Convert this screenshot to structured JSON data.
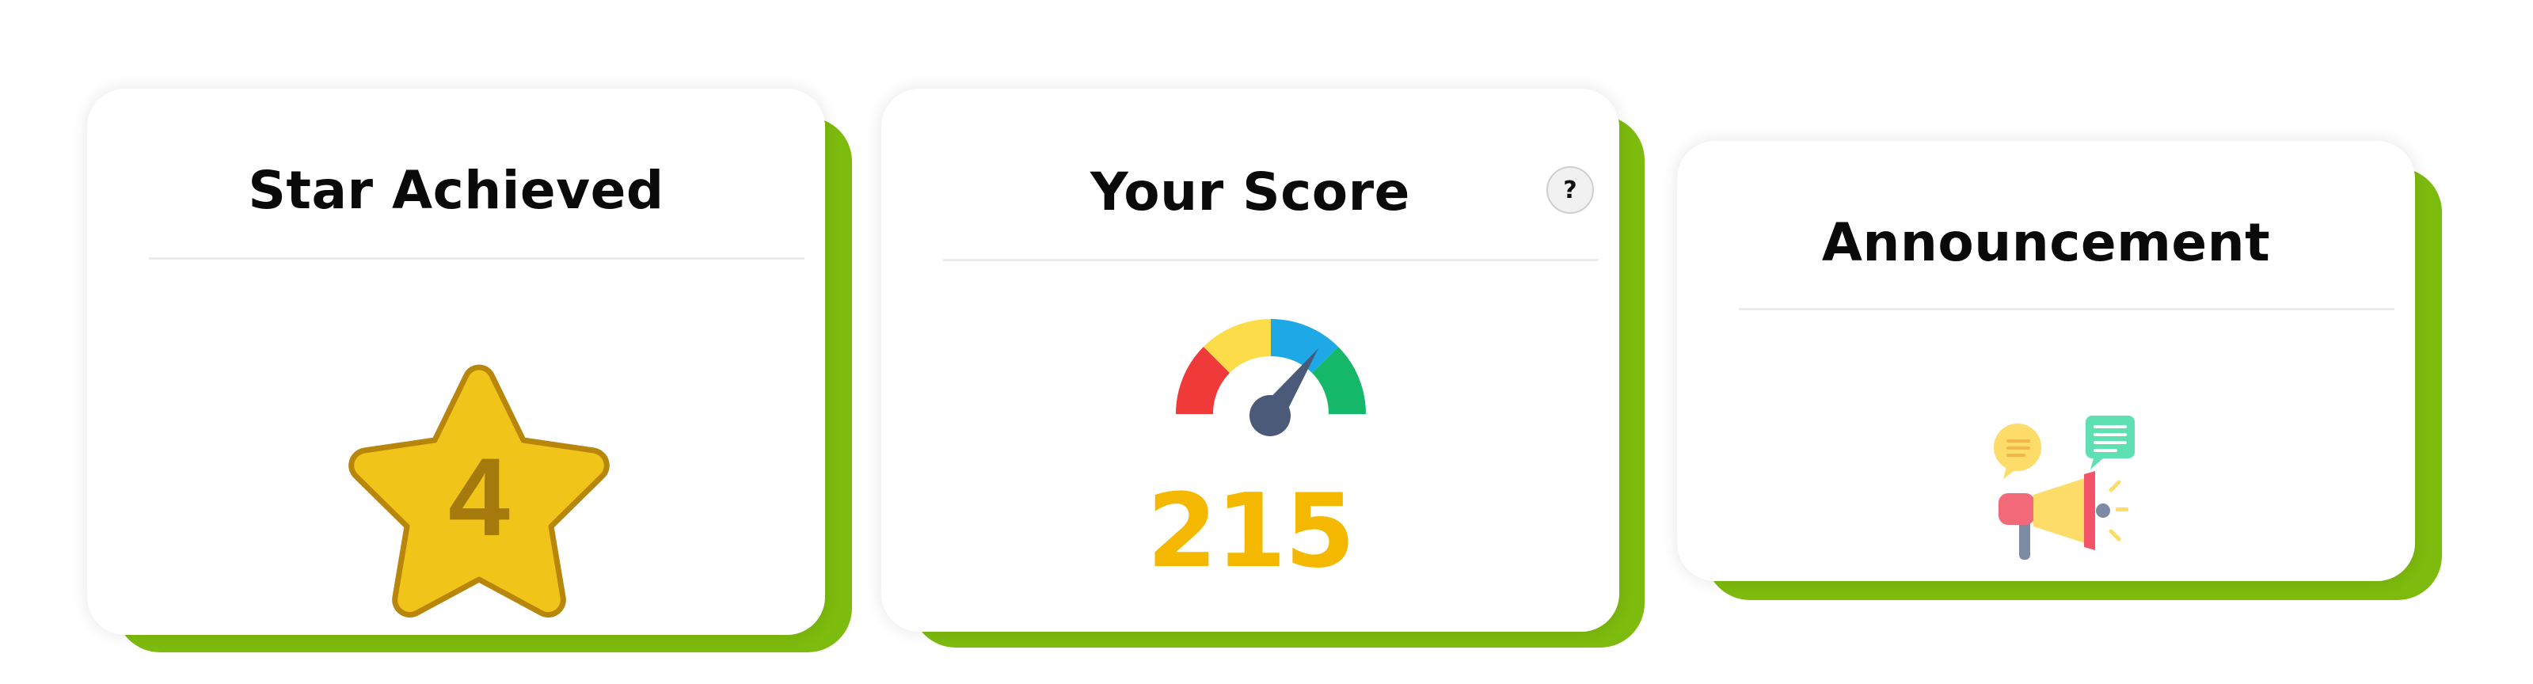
{
  "cards": {
    "star": {
      "title": "Star Achieved",
      "stars_count": "4"
    },
    "score": {
      "title": "Your Score",
      "help_label": "?",
      "score_value": "215"
    },
    "announcement": {
      "title": "Announcement"
    }
  },
  "colors": {
    "accent_green": "#7dbb0e",
    "star_fill": "#f0c419",
    "star_stroke": "#b8860b",
    "score_text": "#f5b800",
    "gauge_red": "#f03a3a",
    "gauge_yellow": "#fddc4a",
    "gauge_blue": "#1ea8e6",
    "gauge_green": "#15b768",
    "needle": "#4a5a78"
  },
  "icons": {
    "star": "star-icon",
    "gauge": "speedometer-icon",
    "help": "question-icon",
    "announcement": "megaphone-icon"
  }
}
